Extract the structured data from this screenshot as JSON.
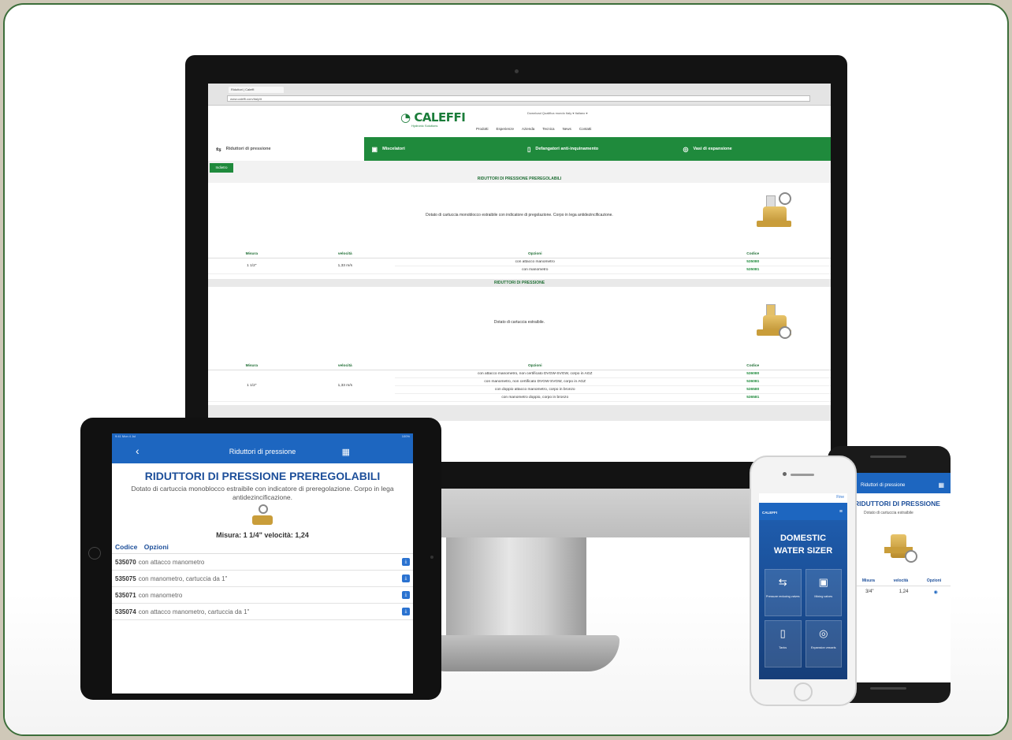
{
  "desktop": {
    "browser": {
      "tab_title": "Riduttori | Caleffi",
      "url": "www.caleffi.com/italy/it"
    },
    "logo": "CALEFFI",
    "logo_sub": "Hydronic Solutions",
    "lang_bar": "Download   Qualifica mondo   Italy   ▾   Italiano ▾",
    "nav": [
      "Prodotti",
      "Esperienze",
      "Azienda",
      "Tecnica",
      "News",
      "Contatti"
    ],
    "categories": [
      {
        "label": "Riduttori di pressione",
        "icon": "⇆"
      },
      {
        "label": "Miscelatori",
        "icon": "▣"
      },
      {
        "label": "Defangatori anti-inquinamento",
        "icon": "▯"
      },
      {
        "label": "Vasi di espansione",
        "icon": "◎"
      }
    ],
    "tab_button": "Indietro",
    "section1": {
      "title": "RIDUTTORI DI PRESSIONE PREREGOLABILI",
      "description": "Dotato di cartuccia monoblocco estraibile con indicatore di pregolazione. Corpo in lega antidezincificazione.",
      "headers": [
        "Misura",
        "velocità",
        "Opzioni",
        "Codice"
      ],
      "size": "1 1/2\"",
      "speed": "1,33 m/s",
      "rows": [
        {
          "option": "con attacco manometro",
          "code": "535080"
        },
        {
          "option": "con manometro",
          "code": "535081"
        }
      ]
    },
    "section2": {
      "title": "RIDUTTORI DI PRESSIONE",
      "description": "Dotato di cartuccia estraibile.",
      "headers": [
        "Misura",
        "velocità",
        "Opzioni",
        "Codice"
      ],
      "size": "1 1/2\"",
      "speed": "1,33 m/s",
      "rows": [
        {
          "option": "con attacco manometro, non certificato DVGW-SVGW, corpo in AGZ",
          "code": "536080"
        },
        {
          "option": "con manometro, non certificato DVGW-SVGW, corpo in AGZ",
          "code": "536081"
        },
        {
          "option": "con doppio attacco manometro, corpo in bronzo",
          "code": "536580"
        },
        {
          "option": "con manometro doppio, corpo in bronzo",
          "code": "536581"
        }
      ]
    }
  },
  "tablet": {
    "status": "9:41  Mon 4 Jul",
    "status_right": "100%",
    "appbar_title": "Riduttori di pressione",
    "heading": "RIDUTTORI DI PRESSIONE PREREGOLABILI",
    "description": "Dotato di cartuccia monoblocco estraibile con indicatore di preregolazione. Corpo in lega antidezincificazione.",
    "measure": "Misura: 1 1/4\" velocità: 1,24",
    "col_code": "Codice",
    "col_options": "Opzioni",
    "rows": [
      {
        "code": "535070",
        "text": "con attacco manometro"
      },
      {
        "code": "535075",
        "text": "con manometro, cartuccia da 1\""
      },
      {
        "code": "535071",
        "text": "con manometro"
      },
      {
        "code": "535074",
        "text": "con attacco manometro, cartuccia da 1\""
      }
    ]
  },
  "iphone": {
    "done": "Fine",
    "brand": "CALEFFI",
    "title_line1": "DOMESTIC",
    "title_line2": "WATER SIZER",
    "tiles": [
      {
        "icon": "⇆",
        "label": "Pressure reducing valves"
      },
      {
        "icon": "▣",
        "label": "Mixing valves"
      },
      {
        "icon": "▯",
        "label": "Tanks"
      },
      {
        "icon": "◎",
        "label": "Expansion vessels"
      }
    ]
  },
  "android": {
    "appbar_title": "Riduttori di pressione",
    "heading": "RIDUTTORI DI PRESSIONE",
    "description": "Dotato di cartuccia estraibile",
    "cols": [
      "Misura",
      "velocità",
      "Opzioni"
    ],
    "row": {
      "size": "3/4\"",
      "speed": "1,24"
    }
  }
}
